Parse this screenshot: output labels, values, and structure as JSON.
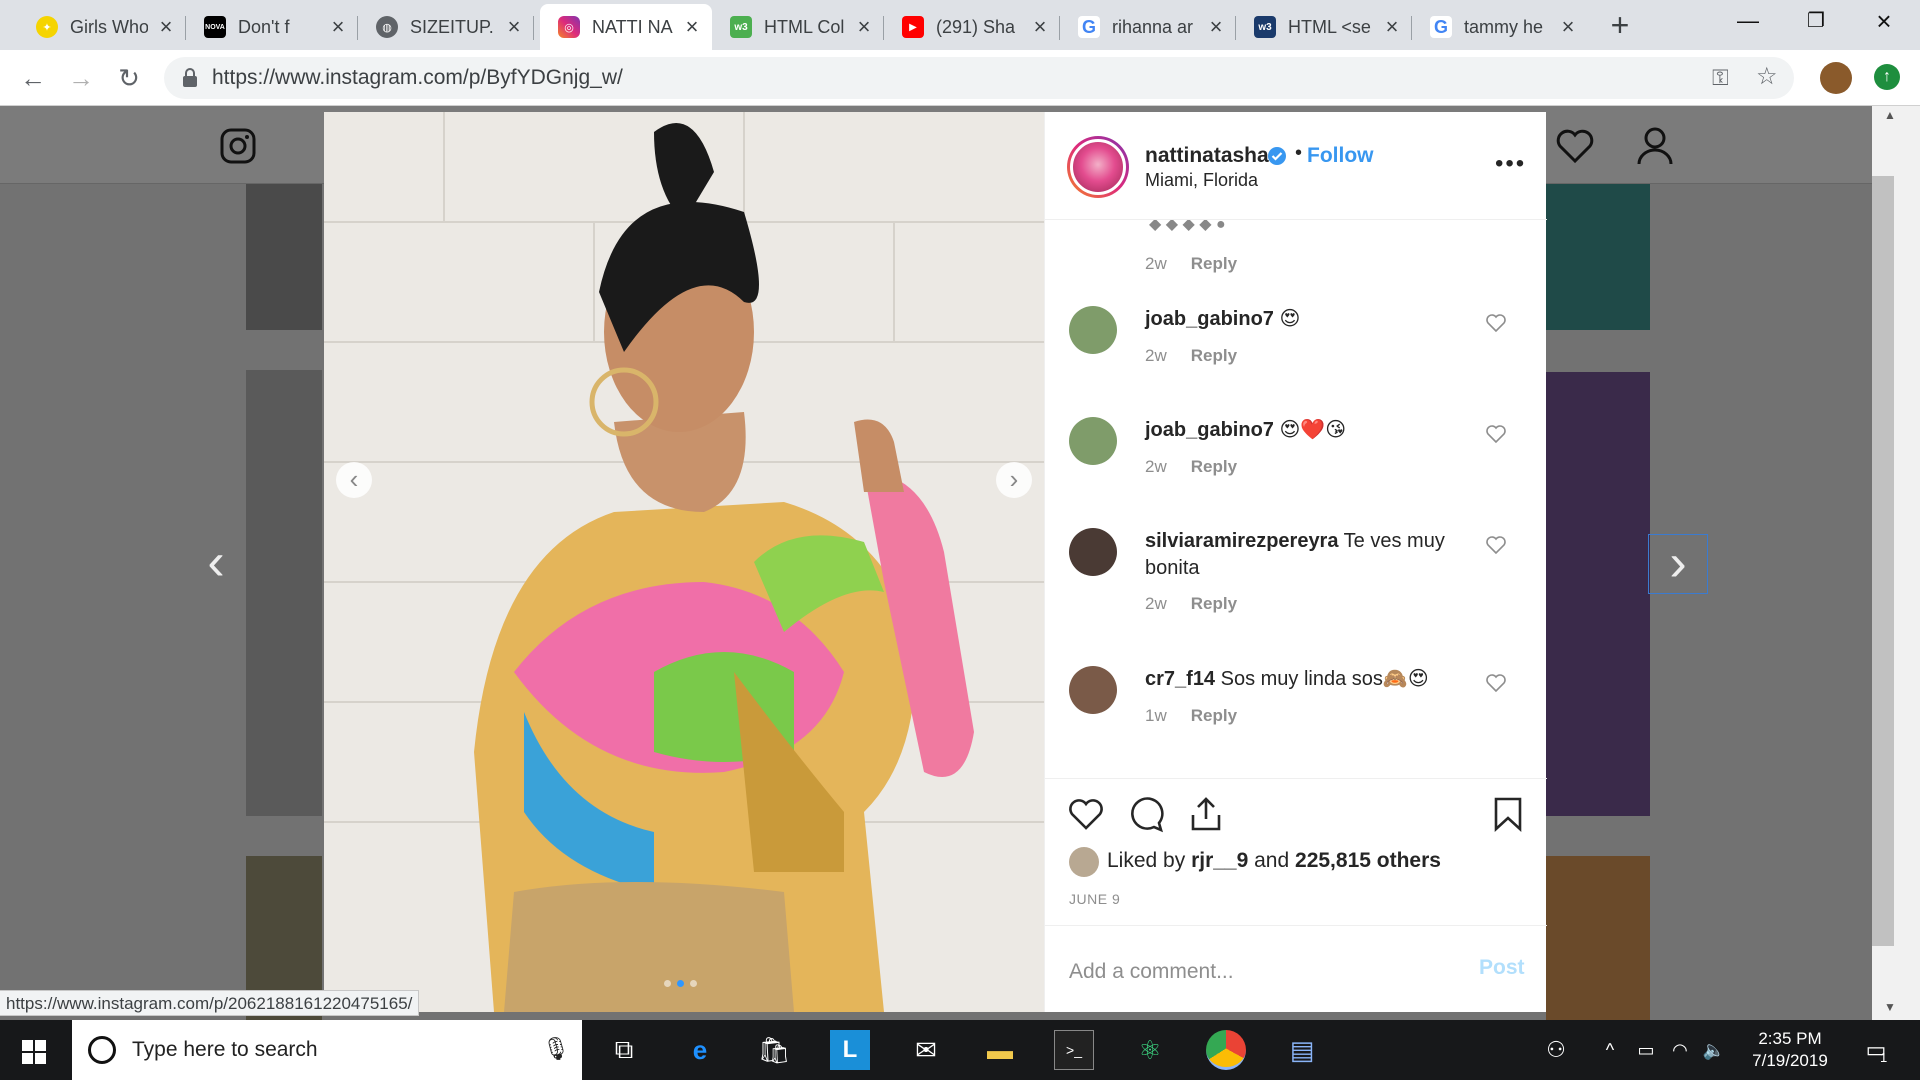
{
  "browser": {
    "tabs": [
      {
        "title": "Girls Who",
        "favicon": "pineapple-icon",
        "color": "#f5d400",
        "active": false
      },
      {
        "title": "Don't f",
        "favicon": "nova-fire-icon",
        "color": "#000000",
        "active": false
      },
      {
        "title": "SIZEITUP.",
        "favicon": "globe-icon",
        "color": "#5f6368",
        "active": false
      },
      {
        "title": "NATTI NA",
        "favicon": "instagram-icon",
        "color": "#c13584",
        "active": true
      },
      {
        "title": "HTML Col",
        "favicon": "w3-icon",
        "color": "#4caf50",
        "active": false
      },
      {
        "title": "(291) Sha",
        "favicon": "youtube-icon",
        "color": "#ff0000",
        "active": false
      },
      {
        "title": "rihanna ar",
        "favicon": "google-icon",
        "color": "#4285f4",
        "active": false
      },
      {
        "title": "HTML <se",
        "favicon": "w3schools-icon",
        "color": "#1a3a6b",
        "active": false
      },
      {
        "title": "tammy he",
        "favicon": "google-icon",
        "color": "#4285f4",
        "active": false
      }
    ],
    "url": "https://www.instagram.com/p/ByfYDGnjg_w/",
    "status_url": "https://www.instagram.com/p/2062188161220475165/"
  },
  "post": {
    "username": "nattinatasha",
    "follow_label": "Follow",
    "location": "Miami, Florida",
    "top_time": "2w",
    "reply_label": "Reply",
    "comments": [
      {
        "user": "joab_gabino7",
        "text": "😍",
        "time": "2w"
      },
      {
        "user": "joab_gabino7",
        "text": "😍❤️😘",
        "time": "2w"
      },
      {
        "user": "silviaramirezpereyra",
        "text": "Te ves muy bonita",
        "time": "2w"
      },
      {
        "user": "cr7_f14",
        "text": "Sos muy linda sos🙈😍",
        "time": "1w"
      }
    ],
    "liked_by_prefix": "Liked by",
    "liked_by_user": "rjr__9",
    "liked_by_and": "and",
    "liked_by_count": "225,815 others",
    "date": "JUNE 9",
    "comment_placeholder": "Add a comment...",
    "post_label": "Post",
    "carousel_index": 1,
    "carousel_count": 3
  },
  "taskbar": {
    "search_placeholder": "Type here to search",
    "time": "2:35 PM",
    "date": "7/19/2019",
    "notification_count": "1"
  },
  "colors": {
    "instagram_blue": "#3897f0",
    "post_disabled": "#b2dffc"
  }
}
